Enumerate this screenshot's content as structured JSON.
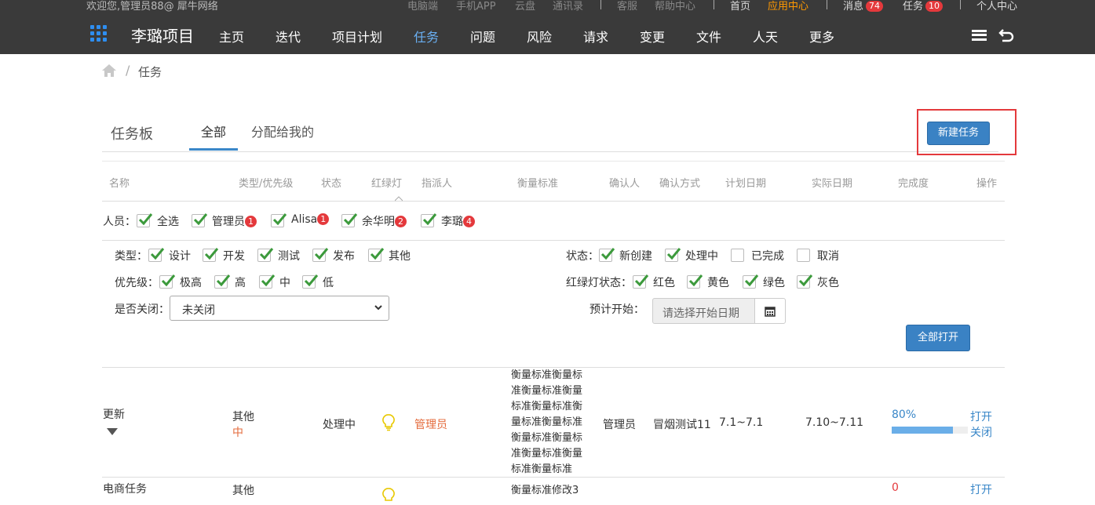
{
  "topbar": {
    "welcome": "欢迎您,管理员88@ 犀牛网络",
    "links": [
      "电脑端",
      "手机APP",
      "云盘",
      "通讯录",
      "客服",
      "帮助中心",
      "首页",
      "应用中心",
      "消息",
      "任务",
      "个人中心"
    ],
    "messages_count": "74",
    "tasks_count": "10"
  },
  "nav": {
    "project_name": "李璐项目",
    "items": [
      "主页",
      "迭代",
      "项目计划",
      "任务",
      "问题",
      "风险",
      "请求",
      "变更",
      "文件",
      "人天",
      "更多"
    ],
    "active": "任务"
  },
  "breadcrumb": {
    "separator": "/",
    "current": "任务"
  },
  "board": {
    "title": "任务板",
    "tabs": [
      "全部",
      "分配给我的"
    ],
    "new_task_button": "新建任务"
  },
  "columns": [
    "名称",
    "类型/优先级",
    "状态",
    "红绿灯",
    "指派人",
    "衡量标准",
    "确认人",
    "确认方式",
    "计划日期",
    "实际日期",
    "完成度",
    "操作"
  ],
  "filters": {
    "people_label": "人员：",
    "people": [
      {
        "name": "全选",
        "checked": true,
        "count": ""
      },
      {
        "name": "管理员",
        "checked": true,
        "count": "1"
      },
      {
        "name": "Alisa",
        "checked": true,
        "count": "1"
      },
      {
        "name": "余华明",
        "checked": true,
        "count": "2"
      },
      {
        "name": "李璐",
        "checked": true,
        "count": "4"
      }
    ],
    "type_label": "类型：",
    "types": [
      "设计",
      "开发",
      "测试",
      "发布",
      "其他"
    ],
    "priority_label": "优先级：",
    "priorities": [
      "极高",
      "高",
      "中",
      "低"
    ],
    "closed_label": "是否关闭：",
    "closed_value": "未关闭",
    "status_label": "状态：",
    "statuses": [
      {
        "name": "新创建",
        "checked": true
      },
      {
        "name": "处理中",
        "checked": true
      },
      {
        "name": "已完成",
        "checked": false
      },
      {
        "name": "取消",
        "checked": false
      }
    ],
    "light_label": "红绿灯状态：",
    "lights": [
      "红色",
      "黄色",
      "绿色",
      "灰色"
    ],
    "start_label": "预计开始：",
    "start_placeholder": "请选择开始日期",
    "open_all_button": "全部打开"
  },
  "rows": [
    {
      "name": "更新",
      "type": "其他",
      "priority": "中",
      "status": "处理中",
      "assignee": "管理员",
      "measure": "衡量标准衡量标准衡量标准衡量标准衡量标准衡量标准衡量标准衡量标准衡量标准衡量标准衡量标准衡量标准",
      "confirmer": "管理员",
      "confirm_method": "冒烟测试11",
      "plan_date": "7.1~7.1",
      "actual_date": "7.10~7.11",
      "progress_text": "80%",
      "progress": 0.8,
      "ops": [
        "打开",
        "关闭"
      ]
    },
    {
      "name": "电商任务",
      "type": "其他",
      "measure": "衡量标准修改3",
      "progress_text": "0",
      "ops": [
        "打开"
      ]
    }
  ],
  "colors": {
    "nav_bg": "#3a3a3a",
    "accent_blue": "#3a82c4",
    "badge_red": "#e4393c",
    "highlight": "#ff9900"
  }
}
